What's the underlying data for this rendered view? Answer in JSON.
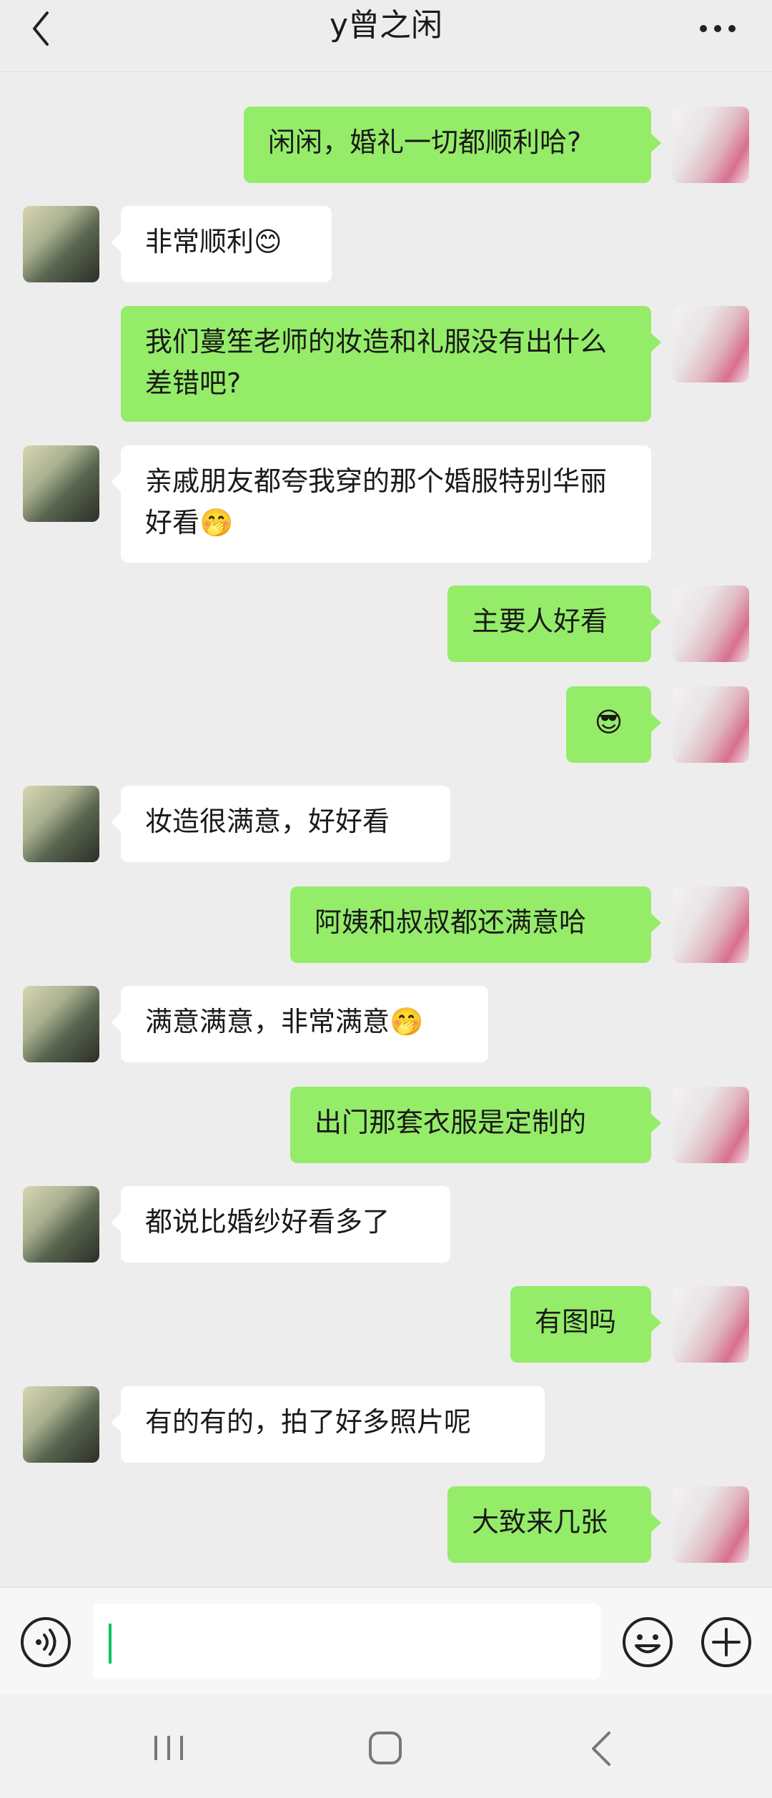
{
  "header": {
    "title": "y曾之闲"
  },
  "messages": [
    {
      "side": "right",
      "text": "闲闲，婚礼一切都顺利哈?"
    },
    {
      "side": "left",
      "text": "非常顺利😊"
    },
    {
      "side": "right",
      "text": "我们蔓笙老师的妆造和礼服没有出什么差错吧?"
    },
    {
      "side": "left",
      "text": "亲戚朋友都夸我穿的那个婚服特别华丽好看🤭"
    },
    {
      "side": "right",
      "text": "主要人好看"
    },
    {
      "side": "right",
      "text": "😎"
    },
    {
      "side": "left",
      "text": "妆造很满意，好好看"
    },
    {
      "side": "right",
      "text": "阿姨和叔叔都还满意哈"
    },
    {
      "side": "left",
      "text": "满意满意，非常满意🤭"
    },
    {
      "side": "right",
      "text": "出门那套衣服是定制的"
    },
    {
      "side": "left",
      "text": "都说比婚纱好看多了"
    },
    {
      "side": "right",
      "text": "有图吗"
    },
    {
      "side": "left",
      "text": "有的有的，拍了好多照片呢"
    },
    {
      "side": "right",
      "text": "大致来几张"
    }
  ],
  "input": {
    "value": ""
  },
  "colors": {
    "sent_bubble": "#95ec69",
    "received_bubble": "#ffffff",
    "background": "#ededed",
    "caret": "#07c160"
  },
  "icons": {
    "back": "chevron-left-icon",
    "more": "more-dots-icon",
    "voice": "voice-icon",
    "emoji": "emoji-icon",
    "plus": "plus-icon"
  }
}
